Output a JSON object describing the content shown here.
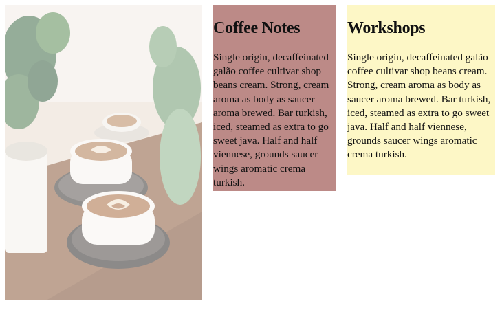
{
  "photo": {
    "description_icon": "coffee-cups-photo"
  },
  "cards": {
    "notes": {
      "title": "Coffee Notes",
      "body": "Single origin, decaffeinated galão coffee cultivar shop beans cream. Strong, cream aroma as body as saucer aroma brewed. Bar turkish, iced, steamed as extra to go sweet java. Half and half viennese, grounds saucer wings aromatic crema turkish.",
      "color": "#bc8a87"
    },
    "workshops": {
      "title": "Workshops",
      "body": "Single origin, decaffeinated galão coffee cultivar shop beans cream. Strong, cream aroma as body as saucer aroma brewed. Bar turkish, iced, steamed as extra to go sweet java. Half and half viennese, grounds saucer wings aromatic crema turkish.",
      "color": "#fdf7c6"
    }
  }
}
